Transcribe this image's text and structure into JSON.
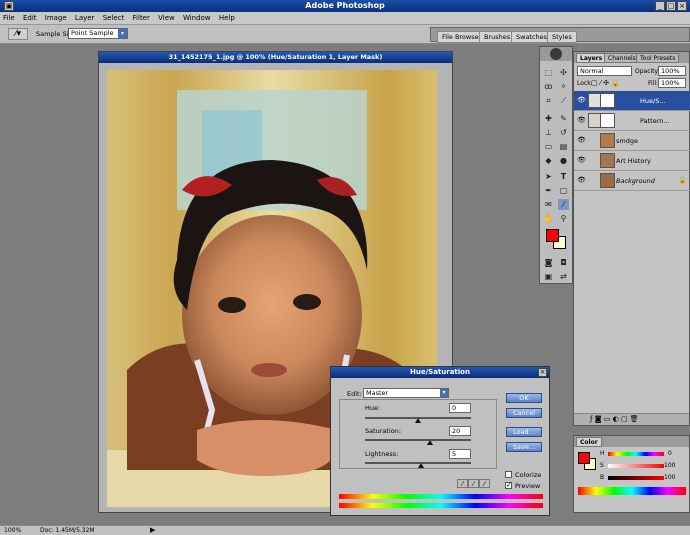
{
  "app": {
    "title": "Adobe Photoshop"
  },
  "menu": [
    "File",
    "Edit",
    "Image",
    "Layer",
    "Select",
    "Filter",
    "View",
    "Window",
    "Help"
  ],
  "options": {
    "sample_size_label": "Sample Size:",
    "sample_size_value": "Point Sample"
  },
  "palette_well": [
    "File Browser",
    "Brushes",
    "Swatches",
    "Styles"
  ],
  "document": {
    "title": "31_1452175_1.jpg @ 100% (Hue/Saturation 1, Layer Mask)"
  },
  "layers_panel": {
    "tabs": [
      "Layers",
      "Channels",
      "Tool Presets"
    ],
    "blend_mode": "Normal",
    "opacity_label": "Opacity:",
    "opacity_value": "100%",
    "lock_label": "Lock:",
    "fill_label": "Fill:",
    "fill_value": "100%",
    "layers": [
      {
        "name": "Hue/S...",
        "selected": true
      },
      {
        "name": "Pattern...",
        "selected": false
      },
      {
        "name": "smdge",
        "selected": false
      },
      {
        "name": "Art History",
        "selected": false
      },
      {
        "name": "Background",
        "selected": false
      }
    ]
  },
  "color_panel": {
    "title": "Color",
    "channels": [
      {
        "label": "H",
        "value": "0"
      },
      {
        "label": "S",
        "value": "100"
      },
      {
        "label": "B",
        "value": "100"
      }
    ]
  },
  "dialog": {
    "title": "Hue/Saturation",
    "edit_label": "Edit:",
    "edit_value": "Master",
    "hue_label": "Hue:",
    "hue_value": "0",
    "saturation_label": "Saturation:",
    "saturation_value": "20",
    "lightness_label": "Lightness:",
    "lightness_value": "5",
    "ok_label": "OK",
    "cancel_label": "Cancel",
    "load_label": "Load...",
    "save_label": "Save...",
    "colorize_label": "Colorize",
    "colorize_checked": false,
    "preview_label": "Preview",
    "preview_checked": true
  },
  "status": {
    "zoom": "100%",
    "doc_info": "Doc: 1.45M/5.32M"
  },
  "colors": {
    "foreground": "#ff0000",
    "background": "#ffffcc",
    "title_blue": "#1b4fa8",
    "layer_selected": "#2a4f9f"
  }
}
